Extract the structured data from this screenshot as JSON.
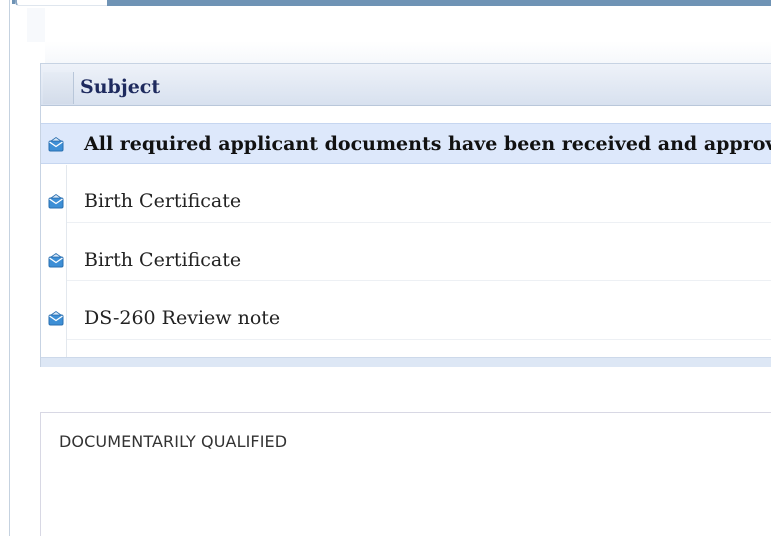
{
  "grid": {
    "header": {
      "subject_label": "Subject"
    },
    "rows": [
      {
        "subject": "All required applicant documents have been received and approved",
        "selected": true,
        "icon": "envelope-open-icon"
      },
      {
        "subject": "Birth Certificate",
        "selected": false,
        "icon": "envelope-open-icon"
      },
      {
        "subject": "Birth Certificate",
        "selected": false,
        "icon": "envelope-open-icon"
      },
      {
        "subject": "DS-260 Review note",
        "selected": false,
        "icon": "envelope-open-icon"
      }
    ]
  },
  "detail": {
    "body_text": "DOCUMENTARILY QUALIFIED"
  },
  "colors": {
    "accent_bar": "#6f93b5",
    "selected_row": "#dde8fb",
    "header_text": "#1e2a5e"
  }
}
